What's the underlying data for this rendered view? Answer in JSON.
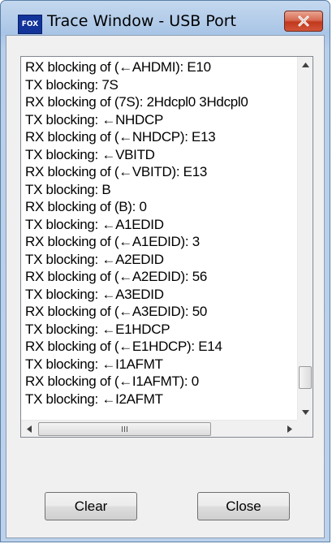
{
  "window": {
    "title": "Trace Window - USB Port",
    "app_icon_text": "FOX"
  },
  "trace": {
    "lines": [
      "RX blocking of (←AHDMI): E10",
      "TX blocking: 7S",
      "RX blocking of (7S): 2Hdcpl0 3Hdcpl0",
      "TX blocking: ←NHDCP",
      "RX blocking of (←NHDCP): E13",
      "TX blocking: ←VBITD",
      "RX blocking of (←VBITD): E13",
      "TX blocking: B",
      "RX blocking of (B): 0",
      "TX blocking: ←A1EDID",
      "RX blocking of (←A1EDID): 3",
      "TX blocking: ←A2EDID",
      "RX blocking of (←A2EDID): 56",
      "TX blocking: ←A3EDID",
      "RX blocking of (←A3EDID): 50",
      "TX blocking: ←E1HDCP",
      "RX blocking of (←E1HDCP): E14",
      "TX blocking: ←I1AFMT",
      "RX blocking of (←I1AFMT): 0",
      "TX blocking: ←I2AFMT"
    ]
  },
  "buttons": {
    "clear_label": "Clear",
    "close_label": "Close"
  },
  "icons": {
    "close": "close-icon",
    "scroll_up": "arrow-up-icon",
    "scroll_down": "arrow-down-icon",
    "scroll_left": "arrow-left-icon",
    "scroll_right": "arrow-right-icon"
  },
  "colors": {
    "app_icon_bg": "#12339a",
    "close_button": "#c7412a"
  }
}
